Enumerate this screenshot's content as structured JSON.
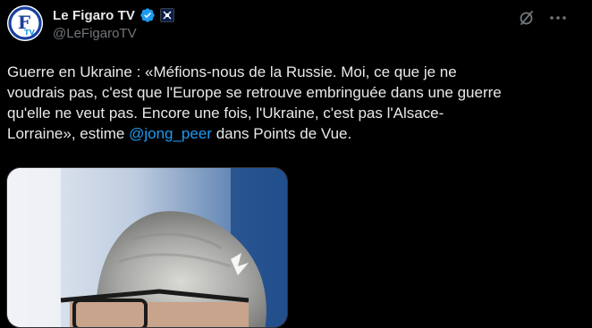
{
  "account": {
    "display_name": "Le Figaro TV",
    "handle": "@LeFigaroTV",
    "avatar_icon": "le-figaro-tv-logo",
    "verified_icon": "verified-badge-icon",
    "affiliate_icon": "affiliate-badge-icon"
  },
  "actions": {
    "grok_icon": "grok-icon",
    "more_icon": "more-dots-icon"
  },
  "tweet": {
    "line1": "Guerre en Ukraine : «Méfions-nous de la Russie. Moi, ce que je ne",
    "line2": "voudrais pas, c'est que l'Europe se retrouve embringuée dans une guerre",
    "line3": "qu'elle ne veut pas. Encore une fois, l'Ukraine, c'est pas l'Alsace-",
    "line4_before": "Lorraine», estime ",
    "mention": "@jong_peer",
    "line4_after": " dans Points de Vue."
  },
  "media": {
    "type": "video-thumbnail"
  },
  "colors": {
    "background": "#000000",
    "text": "#e7e9ea",
    "secondary": "#71767b",
    "link": "#1d9bf0",
    "verified": "#1d9bf0"
  }
}
